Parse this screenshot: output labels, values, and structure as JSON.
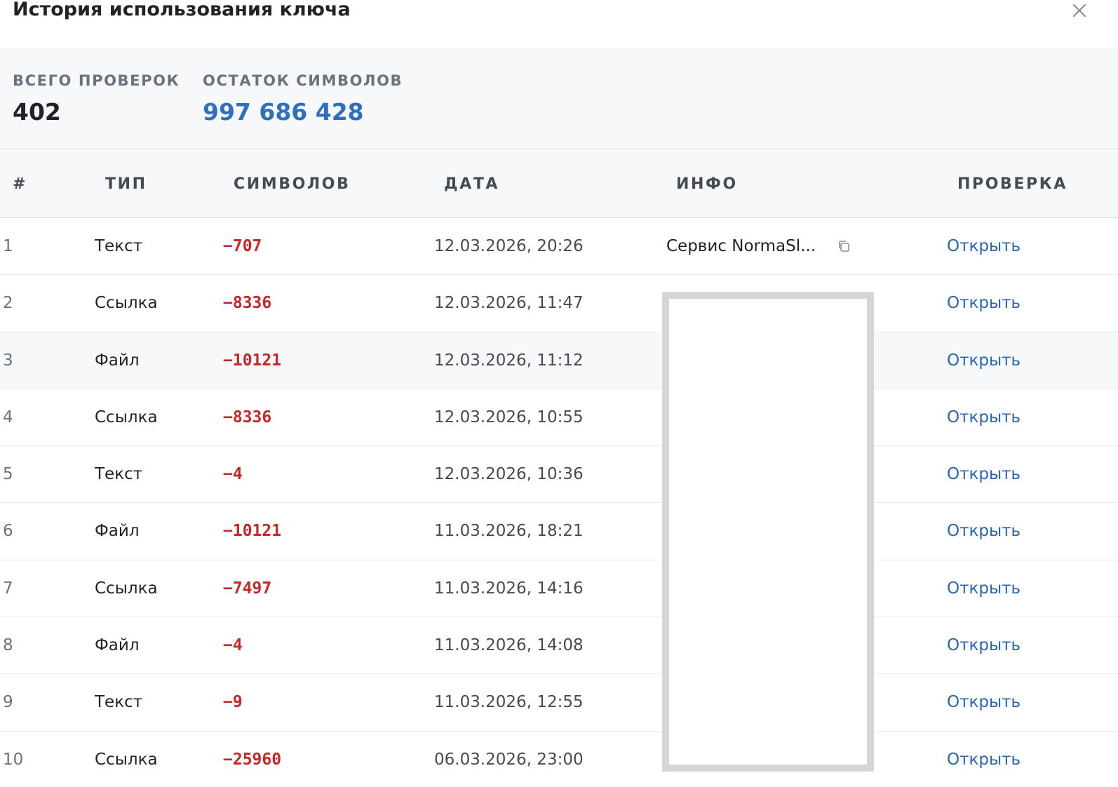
{
  "header": {
    "title": "История использования ключа"
  },
  "stats": {
    "total_checks_label": "ВСЕГО ПРОВЕРОК",
    "total_checks_value": "402",
    "remaining_label": "ОСТАТОК СИМВОЛОВ",
    "remaining_value": "997 686 428"
  },
  "table": {
    "columns": {
      "num": "#",
      "type": "ТИП",
      "chars": "СИМВОЛОВ",
      "date": "ДАТА",
      "info": "ИНФО",
      "check": "ПРОВЕРКА"
    },
    "rows": [
      {
        "num": "1",
        "type": "Текст",
        "chars": "−707",
        "date": "12.03.2026, 20:26",
        "info": "Сервис NormaSl...",
        "action": "Открыть"
      },
      {
        "num": "2",
        "type": "Ссылка",
        "chars": "−8336",
        "date": "12.03.2026, 11:47",
        "info": "",
        "action": "Открыть"
      },
      {
        "num": "3",
        "type": "Файл",
        "chars": "−10121",
        "date": "12.03.2026, 11:12",
        "info": "",
        "action": "Открыть"
      },
      {
        "num": "4",
        "type": "Ссылка",
        "chars": "−8336",
        "date": "12.03.2026, 10:55",
        "info": "",
        "action": "Открыть"
      },
      {
        "num": "5",
        "type": "Текст",
        "chars": "−4",
        "date": "12.03.2026, 10:36",
        "info": "",
        "action": "Открыть"
      },
      {
        "num": "6",
        "type": "Файл",
        "chars": "−10121",
        "date": "11.03.2026, 18:21",
        "info": "",
        "action": "Открыть"
      },
      {
        "num": "7",
        "type": "Ссылка",
        "chars": "−7497",
        "date": "11.03.2026, 14:16",
        "info": "",
        "action": "Открыть"
      },
      {
        "num": "8",
        "type": "Файл",
        "chars": "−4",
        "date": "11.03.2026, 14:08",
        "info": "",
        "action": "Открыть"
      },
      {
        "num": "9",
        "type": "Текст",
        "chars": "−9",
        "date": "11.03.2026, 12:55",
        "info": "",
        "action": "Открыть"
      },
      {
        "num": "10",
        "type": "Ссылка",
        "chars": "−25960",
        "date": "06.03.2026, 23:00",
        "info": "",
        "action": "Открыть"
      }
    ]
  },
  "icons": {
    "close": "close-icon",
    "copy": "copy-icon"
  },
  "colors": {
    "accent_blue": "#2f6fbf",
    "link_blue": "#2866b3",
    "negative_red": "#c62828",
    "stats_background": "#f7f8fa"
  }
}
